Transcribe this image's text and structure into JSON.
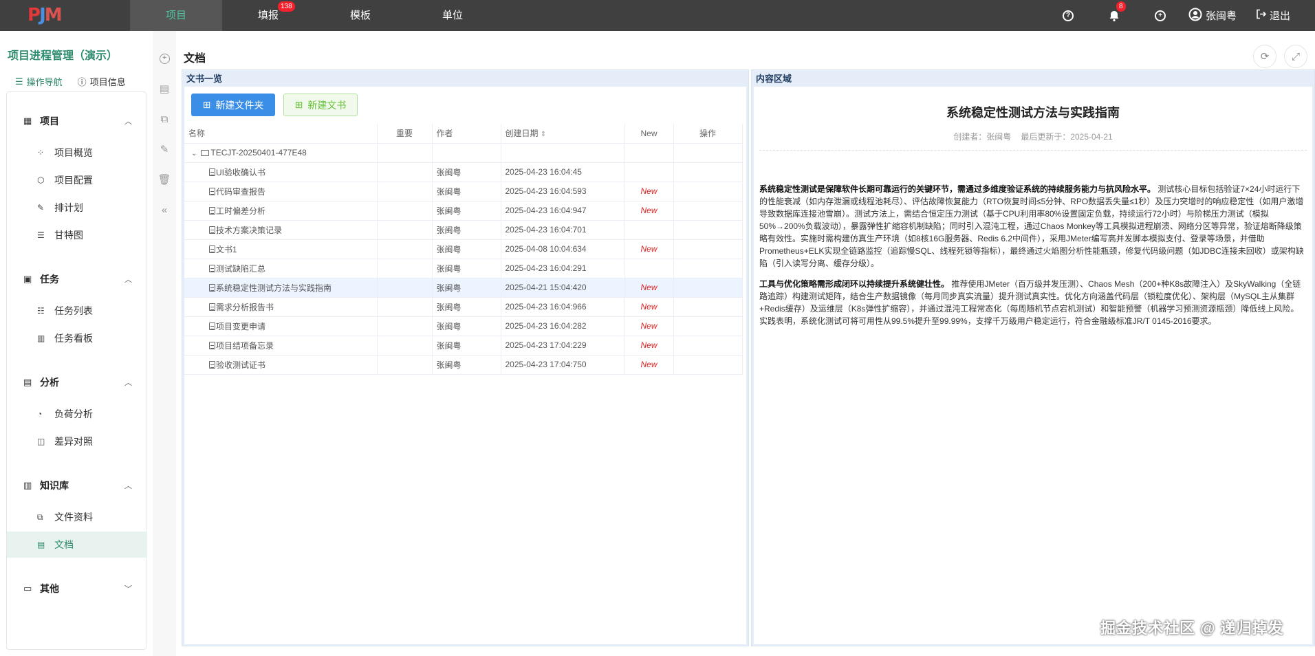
{
  "topbar": {
    "nav": [
      "项目",
      "填报",
      "模板",
      "单位"
    ],
    "report_badge": "138",
    "bell_badge": "8",
    "user": "张闽粤",
    "logout": "退出"
  },
  "sidebar": {
    "project_title": "项目进程管理（演示）",
    "tabs": [
      "操作导航",
      "项目信息"
    ],
    "groups": [
      {
        "label": "项目",
        "items": [
          "项目概览",
          "项目配置",
          "排计划",
          "甘特图"
        ]
      },
      {
        "label": "任务",
        "items": [
          "任务列表",
          "任务看板"
        ]
      },
      {
        "label": "分析",
        "items": [
          "负荷分析",
          "差异对照"
        ]
      },
      {
        "label": "知识库",
        "items": [
          "文件资料",
          "文档"
        ]
      },
      {
        "label": "其他",
        "items": []
      }
    ]
  },
  "page": {
    "title": "文档"
  },
  "list_panel": {
    "title": "文书一览",
    "new_folder": "新建文件夹",
    "new_doc": "新建文书",
    "columns": [
      "名称",
      "重要",
      "作者",
      "创建日期",
      "New",
      "操作"
    ],
    "folder": "TECJT-20250401-477E48",
    "rows": [
      {
        "name": "UI验收确认书",
        "author": "张闽粤",
        "date": "2025-04-23 16:04:45",
        "new": ""
      },
      {
        "name": "代码审查报告",
        "author": "张闽粤",
        "date": "2025-04-23 16:04:593",
        "new": "New"
      },
      {
        "name": "工时偏差分析",
        "author": "张闽粤",
        "date": "2025-04-23 16:04:947",
        "new": "New"
      },
      {
        "name": "技术方案决策记录",
        "author": "张闽粤",
        "date": "2025-04-23 16:04:701",
        "new": ""
      },
      {
        "name": "文书1",
        "author": "张闽粤",
        "date": "2025-04-08 10:04:634",
        "new": "New"
      },
      {
        "name": "测试缺陷汇总",
        "author": "张闽粤",
        "date": "2025-04-23 16:04:291",
        "new": ""
      },
      {
        "name": "系统稳定性测试方法与实践指南",
        "author": "张闽粤",
        "date": "2025-04-21 15:04:420",
        "new": "New"
      },
      {
        "name": "需求分析报告书",
        "author": "张闽粤",
        "date": "2025-04-23 16:04:966",
        "new": "New"
      },
      {
        "name": "项目变更申请",
        "author": "张闽粤",
        "date": "2025-04-23 16:04:282",
        "new": "New"
      },
      {
        "name": "项目结项备忘录",
        "author": "张闽粤",
        "date": "2025-04-23 17:04:229",
        "new": "New"
      },
      {
        "name": "验收测试证书",
        "author": "张闽粤",
        "date": "2025-04-23 17:04:750",
        "new": "New"
      }
    ]
  },
  "content_panel": {
    "title": "内容区域",
    "doc_title": "系统稳定性测试方法与实践指南",
    "creator": "创建者：张闽粤",
    "updated": "最后更新于：2025-04-21",
    "p1_bold": "系统稳定性测试是保障软件长期可靠运行的关键环节，需通过多维度验证系统的持续服务能力与抗风险水平。",
    "p1_text": "测试核心目标包括验证7×24小时运行下的性能衰减（如内存泄漏或线程池耗尽）、评估故障恢复能力（RTO恢复时间≤5分钟、RPO数据丢失量≤1秒）及压力突增时的响应稳定性（如用户激增导致数据库连接池雪崩）。测试方法上，需结合恒定压力测试（基于CPU利用率80%设置固定负载，持续运行72小时）与阶梯压力测试（模拟50%→200%负载波动），暴露弹性扩缩容机制缺陷；同时引入混沌工程，通过Chaos Monkey等工具模拟进程崩溃、网络分区等异常，验证熔断降级策略有效性。实施时需构建仿真生产环境（如8核16G服务器、Redis 6.2中间件），采用JMeter编写高并发脚本模拟支付、登录等场景，并借助Prometheus+ELK实现全链路监控（追踪慢SQL、线程死锁等指标），最终通过火焰图分析性能瓶颈，修复代码级问题（如JDBC连接未回收）或架构缺陷（引入读写分离、缓存分级）。",
    "p2_bold": "工具与优化策略需形成闭环以持续提升系统健壮性。",
    "p2_text": "推荐使用JMeter（百万级并发压测）、Chaos Mesh（200+种K8s故障注入）及SkyWalking（全链路追踪）构建测试矩阵，结合生产数据镜像（每月同步真实流量）提升测试真实性。优化方向涵盖代码层（锁粒度优化）、架构层（MySQL主从集群+Redis缓存）及运维层（K8s弹性扩缩容），并通过混沌工程常态化（每周随机节点宕机测试）和智能预警（机器学习预测资源瓶颈）降低线上风险。实践表明，系统化测试可将可用性从99.5%提升至99.99%，支撑千万级用户稳定运行，符合金融级标准JR/T 0145-2016要求。"
  },
  "watermark": "掘金技术社区 @ 递归掉发"
}
